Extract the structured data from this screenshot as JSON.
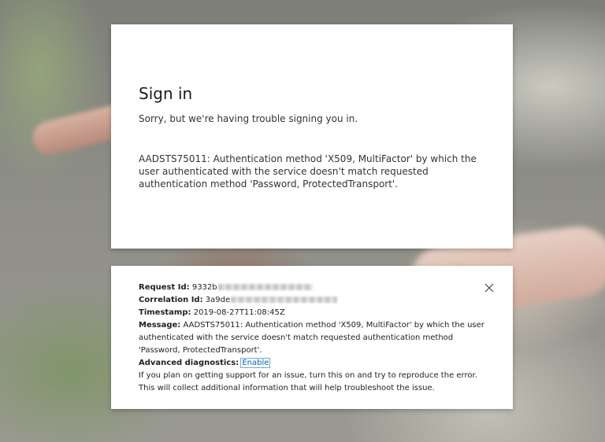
{
  "main": {
    "title": "Sign in",
    "subtitle": "Sorry, but we're having trouble signing you in.",
    "error_message": "AADSTS75011: Authentication method 'X509, MultiFactor' by which the user authenticated with the service doesn't match requested authentication method 'Password, ProtectedTransport'."
  },
  "details": {
    "request_id_label": "Request Id:",
    "request_id_value": "9332b",
    "correlation_id_label": "Correlation Id:",
    "correlation_id_value": "3a9de",
    "timestamp_label": "Timestamp:",
    "timestamp_value": "2019-08-27T11:08:45Z",
    "message_label": "Message:",
    "message_value": "AADSTS75011: Authentication method 'X509, MultiFactor' by which the user authenticated with the service doesn't match requested authentication method 'Password, ProtectedTransport'.",
    "advanced_label": "Advanced diagnostics:",
    "advanced_link": "Enable",
    "help_text": "If you plan on getting support for an issue, turn this on and try to reproduce the error. This will collect additional information that will help troubleshoot the issue.",
    "close_icon": "close-icon"
  }
}
